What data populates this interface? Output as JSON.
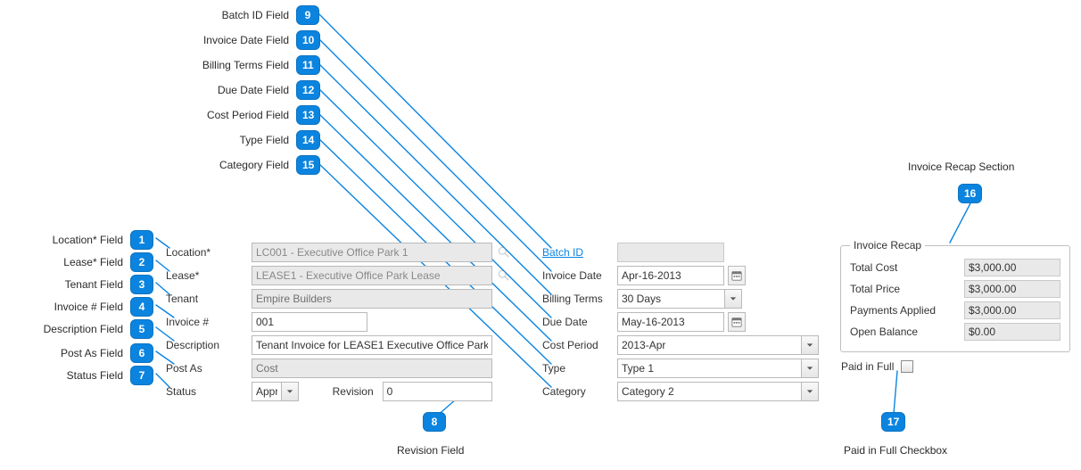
{
  "callouts": {
    "c1": "Location* Field",
    "c2": "Lease* Field",
    "c3": "Tenant Field",
    "c4": "Invoice # Field",
    "c5": "Description Field",
    "c6": "Post As Field",
    "c7": "Status Field",
    "c8": "Revision Field",
    "c9": "Batch ID Field",
    "c10": "Invoice Date Field",
    "c11": "Billing Terms Field",
    "c12": "Due Date Field",
    "c13": "Cost Period Field",
    "c14": "Type Field",
    "c15": "Category Field",
    "c16": "Invoice Recap Section",
    "c17": "Paid in Full Checkbox",
    "n1": "1",
    "n2": "2",
    "n3": "3",
    "n4": "4",
    "n5": "5",
    "n6": "6",
    "n7": "7",
    "n8": "8",
    "n9": "9",
    "n10": "10",
    "n11": "11",
    "n12": "12",
    "n13": "13",
    "n14": "14",
    "n15": "15",
    "n16": "16",
    "n17": "17"
  },
  "left": {
    "location_label": "Location*",
    "location_value": "LC001 - Executive Office Park 1",
    "lease_label": "Lease*",
    "lease_value": "LEASE1 - Executive Office Park Lease",
    "tenant_label": "Tenant",
    "tenant_value": "Empire Builders",
    "invoice_label": "Invoice #",
    "invoice_value": "001",
    "description_label": "Description",
    "description_value": "Tenant Invoice for LEASE1 Executive Office Park",
    "postas_label": "Post As",
    "postas_value": "Cost",
    "status_label": "Status",
    "status_value": "Approved",
    "revision_label": "Revision",
    "revision_value": "0"
  },
  "right": {
    "batch_label": "Batch ID",
    "batch_value": "",
    "invdate_label": "Invoice Date",
    "invdate_value": "Apr-16-2013",
    "billterms_label": "Billing Terms",
    "billterms_value": "30 Days",
    "duedate_label": "Due Date",
    "duedate_value": "May-16-2013",
    "costperiod_label": "Cost Period",
    "costperiod_value": "2013-Apr",
    "type_label": "Type",
    "type_value": "Type 1",
    "category_label": "Category",
    "category_value": "Category 2"
  },
  "recap": {
    "legend": "Invoice Recap",
    "rows": [
      {
        "label": "Total Cost",
        "value": "$3,000.00"
      },
      {
        "label": "Total Price",
        "value": "$3,000.00"
      },
      {
        "label": "Payments Applied",
        "value": "$3,000.00"
      },
      {
        "label": "Open Balance",
        "value": "$0.00"
      }
    ],
    "paid_label": "Paid in Full"
  }
}
